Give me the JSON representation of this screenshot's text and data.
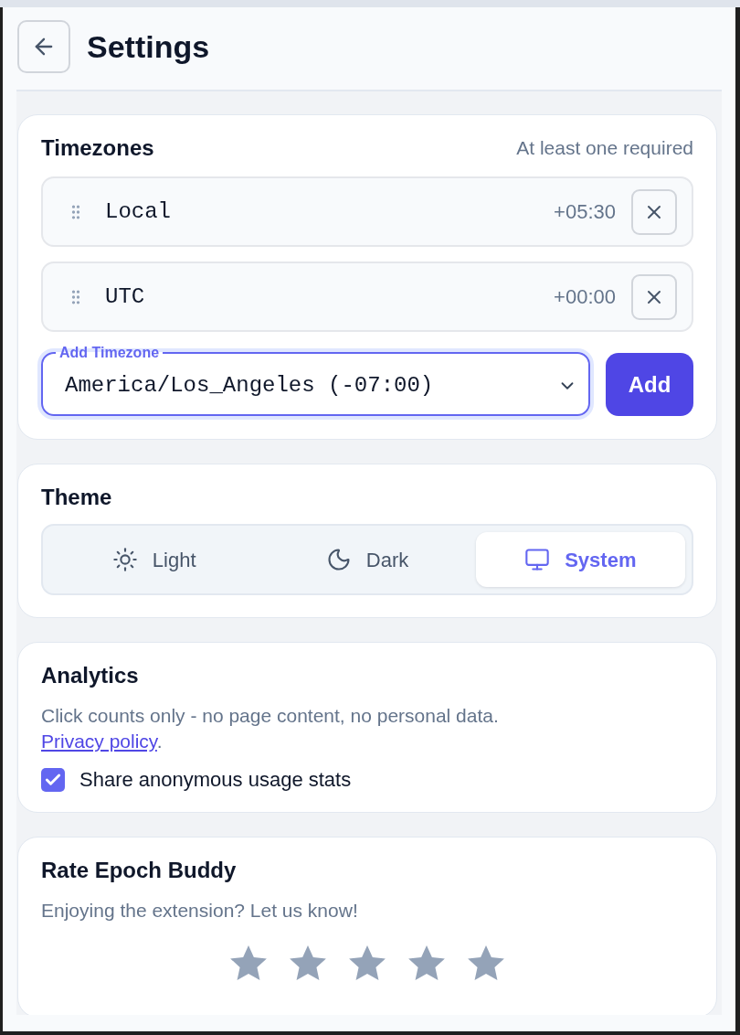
{
  "header": {
    "title": "Settings"
  },
  "timezones": {
    "title": "Timezones",
    "hint": "At least one required",
    "items": [
      {
        "name": "Local",
        "offset": "+05:30"
      },
      {
        "name": "UTC",
        "offset": "+00:00"
      }
    ],
    "add_field": {
      "label": "Add Timezone",
      "value": "America/Los_Angeles (-07:00)"
    },
    "add_button": "Add"
  },
  "theme": {
    "title": "Theme",
    "options": [
      {
        "kind": "light",
        "label": "Light",
        "selected": false
      },
      {
        "kind": "dark",
        "label": "Dark",
        "selected": false
      },
      {
        "kind": "system",
        "label": "System",
        "selected": true
      }
    ]
  },
  "analytics": {
    "title": "Analytics",
    "description": "Click counts only - no page content, no personal data.",
    "link": "Privacy policy",
    "link_suffix": ".",
    "checkbox": {
      "label": "Share anonymous usage stats",
      "checked": true
    }
  },
  "rating": {
    "title": "Rate Epoch Buddy",
    "subtitle": "Enjoying the extension? Let us know!"
  }
}
